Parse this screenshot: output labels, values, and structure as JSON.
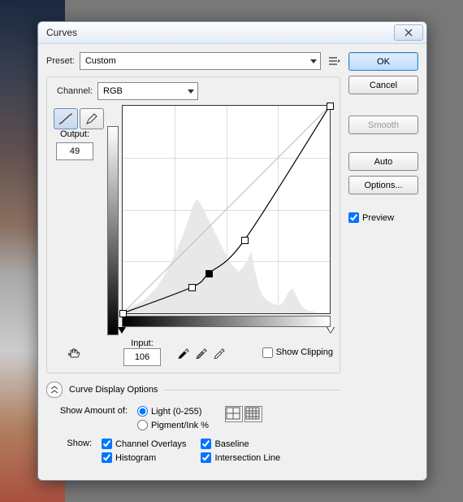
{
  "dialog_title": "Curves",
  "preset_label": "Preset:",
  "preset_value": "Custom",
  "channel_label": "Channel:",
  "channel_value": "RGB",
  "output_label": "Output:",
  "output_value": "49",
  "input_label": "Input:",
  "input_value": "106",
  "show_clipping_label": "Show Clipping",
  "show_clipping_checked": false,
  "curve_display_options_label": "Curve Display Options",
  "show_amount_label": "Show Amount of:",
  "amount_light_label": "Light  (0-255)",
  "amount_pigment_label": "Pigment/Ink %",
  "amount_selected": "light",
  "show_label": "Show:",
  "show_options": {
    "channel_overlays": {
      "label": "Channel Overlays",
      "checked": true
    },
    "baseline": {
      "label": "Baseline",
      "checked": true
    },
    "histogram": {
      "label": "Histogram",
      "checked": true
    },
    "intersection": {
      "label": "Intersection Line",
      "checked": true
    }
  },
  "side": {
    "ok": "OK",
    "cancel": "Cancel",
    "smooth": "Smooth",
    "auto": "Auto",
    "options": "Options...",
    "preview_label": "Preview",
    "preview_checked": true
  },
  "chart_data": {
    "type": "line",
    "title": "Tone curve",
    "xlabel": "Input",
    "ylabel": "Output",
    "xlim": [
      0,
      255
    ],
    "ylim": [
      0,
      255
    ],
    "control_points": [
      {
        "input": 0,
        "output": 0
      },
      {
        "input": 85,
        "output": 32,
        "selected": false
      },
      {
        "input": 106,
        "output": 49,
        "selected": true
      },
      {
        "input": 150,
        "output": 90,
        "selected": false
      },
      {
        "input": 255,
        "output": 255
      }
    ],
    "baseline": [
      [
        0,
        0
      ],
      [
        255,
        255
      ]
    ],
    "histogram_bins": [
      0,
      0.02,
      0.03,
      0.04,
      0.05,
      0.06,
      0.08,
      0.1,
      0.12,
      0.15,
      0.18,
      0.22,
      0.26,
      0.3,
      0.35,
      0.4,
      0.46,
      0.52,
      0.55,
      0.52,
      0.48,
      0.44,
      0.4,
      0.36,
      0.32,
      0.28,
      0.24,
      0.22,
      0.2,
      0.22,
      0.25,
      0.3,
      0.2,
      0.12,
      0.08,
      0.06,
      0.05,
      0.04,
      0.04,
      0.06,
      0.1,
      0.12,
      0.08,
      0.04,
      0.02,
      0.01,
      0.01,
      0.0,
      0.0,
      0.0,
      0.0
    ]
  }
}
